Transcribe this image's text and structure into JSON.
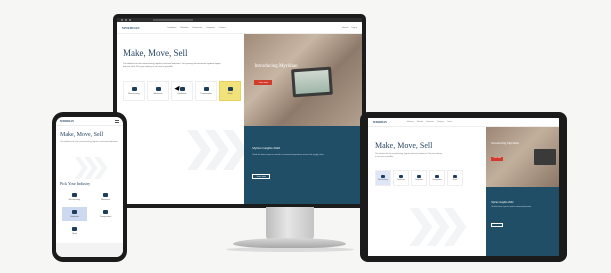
{
  "site": {
    "logo": "MYRIDIAN",
    "nav": [
      "Industries",
      "Solutions",
      "Resources",
      "Company",
      "Contact"
    ],
    "nav_right": [
      "Search",
      "Log in"
    ]
  },
  "hero": {
    "title": "Make, Move, Sell",
    "body": "The solutions for the manufacturing, logistics and retail industries. Your journey into connected systems begins with one click. Pick your industry to see what is possible.",
    "photo_headline": "Introducing Myridian",
    "photo_button": "Learn more"
  },
  "categories": [
    {
      "label": "Manufacturing"
    },
    {
      "label": "Warehouse"
    },
    {
      "label": "Distribution"
    },
    {
      "label": "Transportation"
    },
    {
      "label": "Retail"
    }
  ],
  "promo": {
    "title": "Myrian Insights 2022",
    "body": "Read the latest report on trends in connected operations across the supply chain.",
    "button": "Learn more"
  },
  "phone": {
    "title": "Make, Move, Sell",
    "body": "The solutions for the manufacturing, logistics and retail industries.",
    "industry_heading": "Pick Your Industry",
    "items": [
      {
        "label": "Manufacturing"
      },
      {
        "label": "Warehouse"
      },
      {
        "label": "Distribution"
      },
      {
        "label": "Transportation"
      },
      {
        "label": "Retail"
      }
    ]
  },
  "tablet": {
    "title": "Make, Move, Sell",
    "body": "The solutions for the manufacturing, logistics and retail industries. Pick your industry to see what is possible.",
    "photo_headline": "Introducing Myridian",
    "photo_button": "Learn more",
    "promo_title": "Myrian Insights 2022",
    "promo_body": "Read the latest report on trends in connected operations.",
    "promo_button": "Learn more"
  },
  "colors": {
    "brand_navy": "#1e3d5c",
    "accent_yellow": "#f2e27a",
    "accent_red": "#d23b2c",
    "promo_teal": "#1f4e66"
  }
}
